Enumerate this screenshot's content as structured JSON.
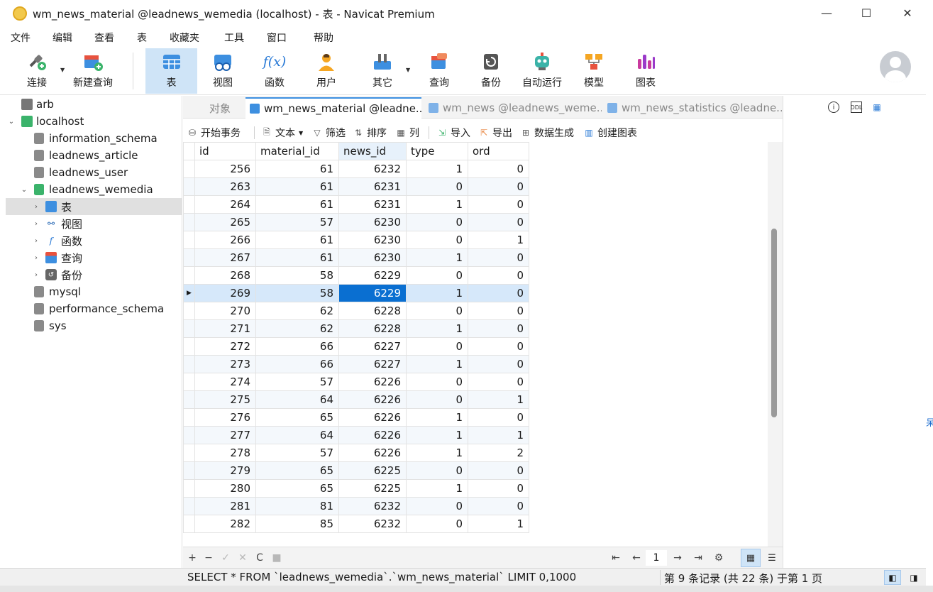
{
  "window": {
    "title": "wm_news_material @leadnews_wemedia (localhost) - 表 - Navicat Premium",
    "controls": {
      "minimize": "—",
      "maximize": "☐",
      "close": "✕"
    }
  },
  "menu": [
    "文件",
    "编辑",
    "查看",
    "表",
    "收藏夹",
    "工具",
    "窗口",
    "帮助"
  ],
  "toolbar": {
    "buttons": [
      {
        "label": "连接",
        "icon": "connection-icon"
      },
      {
        "label": "新建查询",
        "icon": "new-query-icon"
      },
      {
        "label": "表",
        "icon": "table-icon",
        "active": true
      },
      {
        "label": "视图",
        "icon": "view-icon"
      },
      {
        "label": "函数",
        "icon": "function-icon"
      },
      {
        "label": "用户",
        "icon": "user-icon"
      },
      {
        "label": "其它",
        "icon": "other-icon"
      },
      {
        "label": "查询",
        "icon": "query-icon"
      },
      {
        "label": "备份",
        "icon": "backup-icon"
      },
      {
        "label": "自动运行",
        "icon": "automation-icon"
      },
      {
        "label": "模型",
        "icon": "model-icon"
      },
      {
        "label": "图表",
        "icon": "chart-icon"
      }
    ],
    "function_glyph": "f(x)"
  },
  "sidebar": {
    "items": [
      {
        "label": "arb",
        "type": "connection"
      },
      {
        "label": "localhost",
        "type": "connection",
        "expanded": true
      },
      {
        "label": "information_schema",
        "type": "database"
      },
      {
        "label": "leadnews_article",
        "type": "database"
      },
      {
        "label": "leadnews_user",
        "type": "database"
      },
      {
        "label": "leadnews_wemedia",
        "type": "database",
        "expanded": true
      },
      {
        "label": "表",
        "type": "tables"
      },
      {
        "label": "视图",
        "type": "views"
      },
      {
        "label": "函数",
        "type": "functions"
      },
      {
        "label": "查询",
        "type": "queries"
      },
      {
        "label": "备份",
        "type": "backups"
      },
      {
        "label": "mysql",
        "type": "database"
      },
      {
        "label": "performance_schema",
        "type": "database"
      },
      {
        "label": "sys",
        "type": "database"
      }
    ]
  },
  "tabs": [
    {
      "label": "对象"
    },
    {
      "label": "wm_news_material @leadne...",
      "active": true
    },
    {
      "label": "wm_news @leadnews_weme..."
    },
    {
      "label": "wm_news_statistics @leadne..."
    }
  ],
  "table_toolbar": {
    "begin_transaction": "开始事务",
    "text": "文本",
    "filter": "筛选",
    "sort": "排序",
    "columns": "列",
    "import": "导入",
    "export": "导出",
    "data_generation": "数据生成",
    "create_chart": "创建图表"
  },
  "grid": {
    "columns": [
      "id",
      "material_id",
      "news_id",
      "type",
      "ord"
    ],
    "rows": [
      [
        "256",
        "61",
        "6232",
        "1",
        "0"
      ],
      [
        "263",
        "61",
        "6231",
        "0",
        "0"
      ],
      [
        "264",
        "61",
        "6231",
        "1",
        "0"
      ],
      [
        "265",
        "57",
        "6230",
        "0",
        "0"
      ],
      [
        "266",
        "61",
        "6230",
        "0",
        "1"
      ],
      [
        "267",
        "61",
        "6230",
        "1",
        "0"
      ],
      [
        "268",
        "58",
        "6229",
        "0",
        "0"
      ],
      [
        "269",
        "58",
        "6229",
        "1",
        "0"
      ],
      [
        "270",
        "62",
        "6228",
        "0",
        "0"
      ],
      [
        "271",
        "62",
        "6228",
        "1",
        "0"
      ],
      [
        "272",
        "66",
        "6227",
        "0",
        "0"
      ],
      [
        "273",
        "66",
        "6227",
        "1",
        "0"
      ],
      [
        "274",
        "57",
        "6226",
        "0",
        "0"
      ],
      [
        "275",
        "64",
        "6226",
        "0",
        "1"
      ],
      [
        "276",
        "65",
        "6226",
        "1",
        "0"
      ],
      [
        "277",
        "64",
        "6226",
        "1",
        "1"
      ],
      [
        "278",
        "57",
        "6226",
        "1",
        "2"
      ],
      [
        "279",
        "65",
        "6225",
        "0",
        "0"
      ],
      [
        "280",
        "65",
        "6225",
        "1",
        "0"
      ],
      [
        "281",
        "81",
        "6232",
        "0",
        "0"
      ],
      [
        "282",
        "85",
        "6232",
        "0",
        "1"
      ]
    ],
    "selected_row": 7,
    "focused_column": 2
  },
  "bottom_nav": {
    "add": "+",
    "remove": "−",
    "apply": "✓",
    "cancel": "✕",
    "refresh": "C",
    "stop": "■",
    "first": "⇤",
    "prev": "←",
    "page": "1",
    "next": "→",
    "last": "⇥",
    "settings": "⚙"
  },
  "status": {
    "sql": "SELECT * FROM `leadnews_wemedia`.`wm_news_material` LIMIT 0,1000",
    "record": "第 9 条记录 (共 22 条) 于第 1 页"
  },
  "edge_glyph": "呆"
}
